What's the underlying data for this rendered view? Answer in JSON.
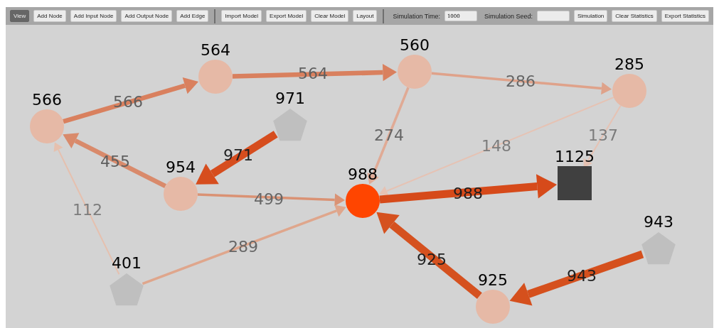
{
  "toolbar": {
    "buttons": [
      {
        "label": "View",
        "selected": true
      },
      {
        "label": "Add Node",
        "selected": false
      },
      {
        "label": "Add Input Node",
        "selected": false
      },
      {
        "label": "Add Output Node",
        "selected": false
      },
      {
        "label": "Add Edge",
        "selected": false
      }
    ],
    "model_buttons": [
      {
        "label": "Import Model"
      },
      {
        "label": "Export Model"
      },
      {
        "label": "Clear Model"
      },
      {
        "label": "Layout"
      }
    ],
    "simulation_time": {
      "label": "Simulation Time:",
      "value": "1000"
    },
    "simulation_seed": {
      "label": "Simulation Seed:"
    },
    "simulation_buttons": [
      {
        "label": "Simulation"
      },
      {
        "label": "Clear Statistics"
      },
      {
        "label": "Export Statistics"
      }
    ]
  },
  "graph": {
    "nodes": [
      {
        "label": "566",
        "kind": "circle",
        "color": "#e6b9a6"
      },
      {
        "label": "564",
        "kind": "circle",
        "color": "#e6b9a6"
      },
      {
        "label": "560",
        "kind": "circle",
        "color": "#e6b9a6"
      },
      {
        "label": "285",
        "kind": "circle",
        "color": "#e6b9a6"
      },
      {
        "label": "971",
        "kind": "pentagon",
        "color": "#bfbfbf"
      },
      {
        "label": "954",
        "kind": "circle",
        "color": "#e6b9a6"
      },
      {
        "label": "988",
        "kind": "circle",
        "color": "#ff4500"
      },
      {
        "label": "1125",
        "kind": "square",
        "color": "#404040"
      },
      {
        "label": "943",
        "kind": "pentagon",
        "color": "#bfbfbf"
      },
      {
        "label": "401",
        "kind": "pentagon",
        "color": "#bfbfbf"
      },
      {
        "label": "925",
        "kind": "circle",
        "color": "#e6b9a6"
      }
    ],
    "edges": [
      {
        "label": "566",
        "kind": "thick",
        "color": "#d9805e"
      },
      {
        "label": "564",
        "kind": "thick",
        "color": "#d9805e"
      },
      {
        "label": "286",
        "kind": "medium",
        "color": "#dfa28a"
      },
      {
        "label": "274",
        "kind": "medium",
        "color": "#e0aa95"
      },
      {
        "label": "148",
        "kind": "thin",
        "color": "#e6c2b3"
      },
      {
        "label": "137",
        "kind": "thin",
        "color": "#e6c2b3"
      },
      {
        "label": "971",
        "kind": "heavy",
        "color": "#d64d1e"
      },
      {
        "label": "455",
        "kind": "thick",
        "color": "#d98a6b"
      },
      {
        "label": "499",
        "kind": "medium",
        "color": "#da9274"
      },
      {
        "label": "988",
        "kind": "heavy",
        "color": "#d64a1a"
      },
      {
        "label": "112",
        "kind": "thin",
        "color": "#e6c0ae"
      },
      {
        "label": "289",
        "kind": "medium",
        "color": "#dfa68c"
      },
      {
        "label": "925",
        "kind": "heavy",
        "color": "#d5511f"
      },
      {
        "label": "943",
        "kind": "heavy",
        "color": "#d5501d"
      }
    ]
  }
}
